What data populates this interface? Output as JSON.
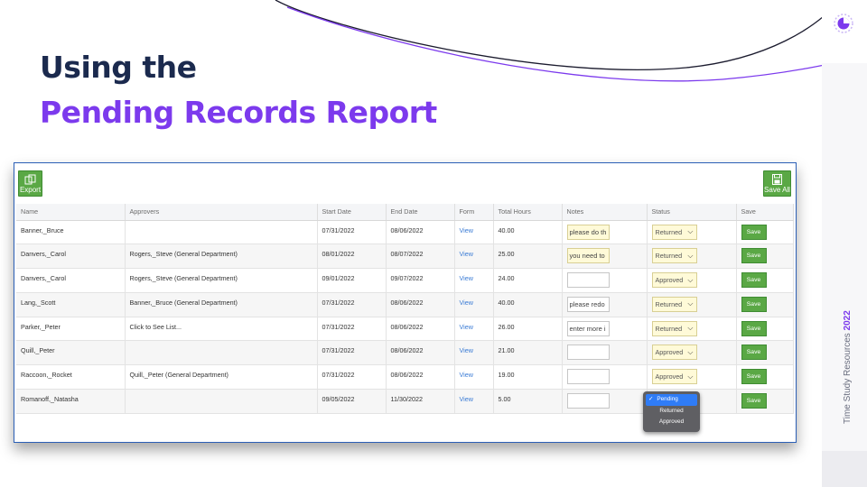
{
  "slide": {
    "title_line1": "Using the",
    "title_line2": "Pending Records Report",
    "footer_text": "Time Study Resources",
    "footer_year": "2022",
    "colors": {
      "navy": "#1b2a4e",
      "purple": "#7c3aed",
      "green": "#5aa845",
      "link": "#3a7bd5"
    },
    "logo_icon": "circular-progress-logo-icon"
  },
  "toolbar": {
    "export_label": "Export",
    "export_icon": "export-icon",
    "save_all_label": "Save All",
    "save_all_icon": "floppy-disk-icon"
  },
  "table": {
    "columns": [
      "Name",
      "Approvers",
      "Start Date",
      "End Date",
      "Form",
      "Total Hours",
      "Notes",
      "Status",
      "Save"
    ],
    "rows": [
      {
        "name": "Banner,_Bruce",
        "approvers": "",
        "start": "07/31/2022",
        "end": "08/06/2022",
        "form": "View",
        "hours": "40.00",
        "notes": "please do th",
        "status": "Returned",
        "save": "Save"
      },
      {
        "name": "Danvers,_Carol",
        "approvers": "Rogers,_Steve (General Department)",
        "start": "08/01/2022",
        "end": "08/07/2022",
        "form": "View",
        "hours": "25.00",
        "notes": "you need to",
        "status": "Returned",
        "save": "Save"
      },
      {
        "name": "Danvers,_Carol",
        "approvers": "Rogers,_Steve (General Department)",
        "start": "09/01/2022",
        "end": "09/07/2022",
        "form": "View",
        "hours": "24.00",
        "notes": "",
        "status": "Approved",
        "save": "Save"
      },
      {
        "name": "Lang,_Scott",
        "approvers": "Banner,_Bruce (General Department)",
        "start": "07/31/2022",
        "end": "08/06/2022",
        "form": "View",
        "hours": "40.00",
        "notes": "please redo",
        "status": "Returned",
        "save": "Save"
      },
      {
        "name": "Parker,_Peter",
        "approvers": "Click to See List...",
        "start": "07/31/2022",
        "end": "08/06/2022",
        "form": "View",
        "hours": "26.00",
        "notes": "enter more i",
        "status": "Returned",
        "save": "Save"
      },
      {
        "name": "Quill,_Peter",
        "approvers": "",
        "start": "07/31/2022",
        "end": "08/06/2022",
        "form": "View",
        "hours": "21.00",
        "notes": "",
        "status": "Approved",
        "save": "Save"
      },
      {
        "name": "Raccoon,_Rocket",
        "approvers": "Quill,_Peter (General Department)",
        "start": "07/31/2022",
        "end": "08/06/2022",
        "form": "View",
        "hours": "19.00",
        "notes": "",
        "status": "Approved",
        "save": "Save"
      },
      {
        "name": "Romanoff,_Natasha",
        "approvers": "",
        "start": "09/05/2022",
        "end": "11/30/2022",
        "form": "View",
        "hours": "5.00",
        "notes": "",
        "status": "",
        "save": "Save"
      }
    ]
  },
  "status_dropdown": {
    "options": [
      "Pending",
      "Returned",
      "Approved"
    ],
    "selected": "Pending",
    "check_glyph": "✓"
  }
}
